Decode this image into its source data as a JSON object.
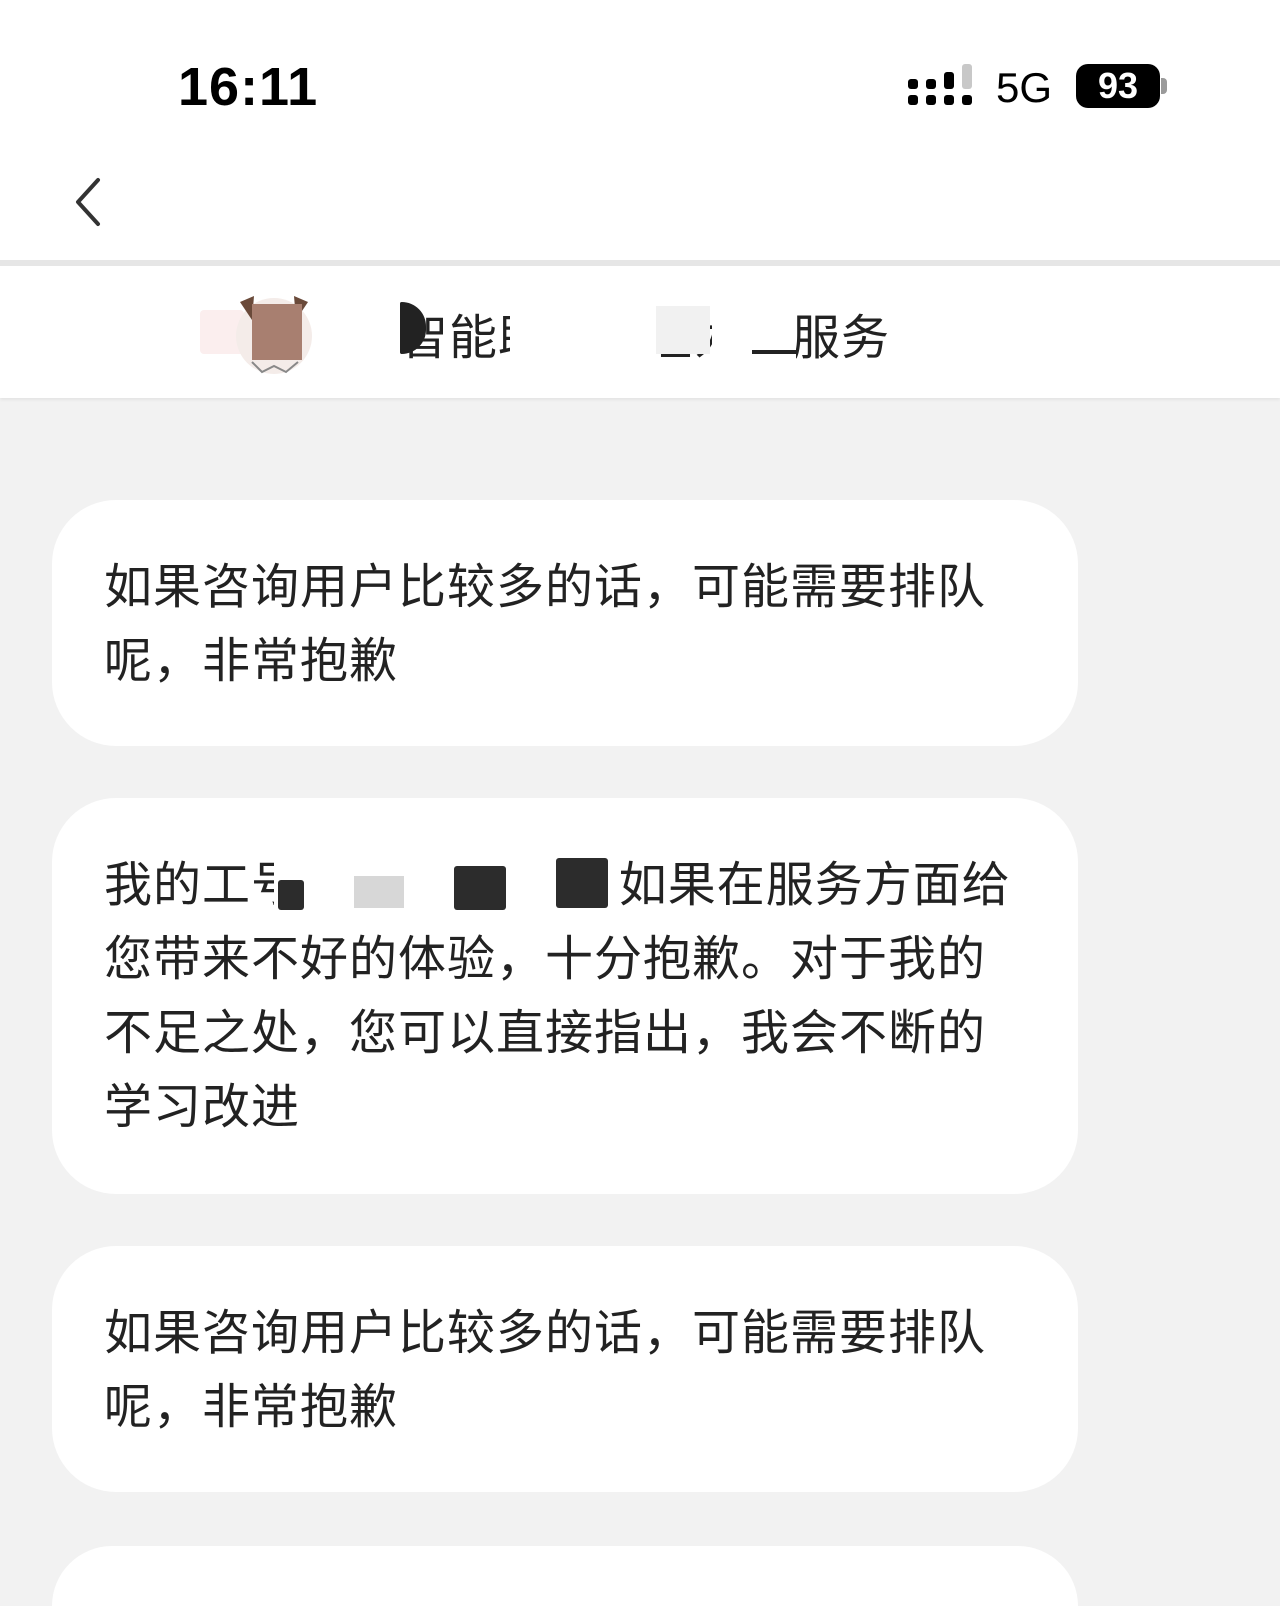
{
  "status_bar": {
    "time": "16:11",
    "network": "5G",
    "battery": "93",
    "icons": [
      "cellular-signal-icon",
      "battery-icon"
    ]
  },
  "nav_bar": {
    "back_icon": "chevron-left-icon"
  },
  "agent_bar": {
    "status_text": "智能助手正在为您服务",
    "avatar_icon": "cat-avatar"
  },
  "messages": [
    {
      "sender": "agent",
      "text": "如果咨询用户比较多的话，可能需要排队呢，非常抱歉"
    },
    {
      "sender": "agent",
      "text": "我的工号是1000000，如果在服务方面给您带来不好的体验，十分抱歉。对于我的不足之处，您可以直接指出，我会不断的学习改进"
    },
    {
      "sender": "agent",
      "text": "如果咨询用户比较多的话，可能需要排队呢，非常抱歉"
    },
    {
      "sender": "agent",
      "text": ""
    }
  ],
  "colors": {
    "chat_background": "#f2f2f2",
    "bubble_background": "#ffffff",
    "text": "#222222"
  }
}
